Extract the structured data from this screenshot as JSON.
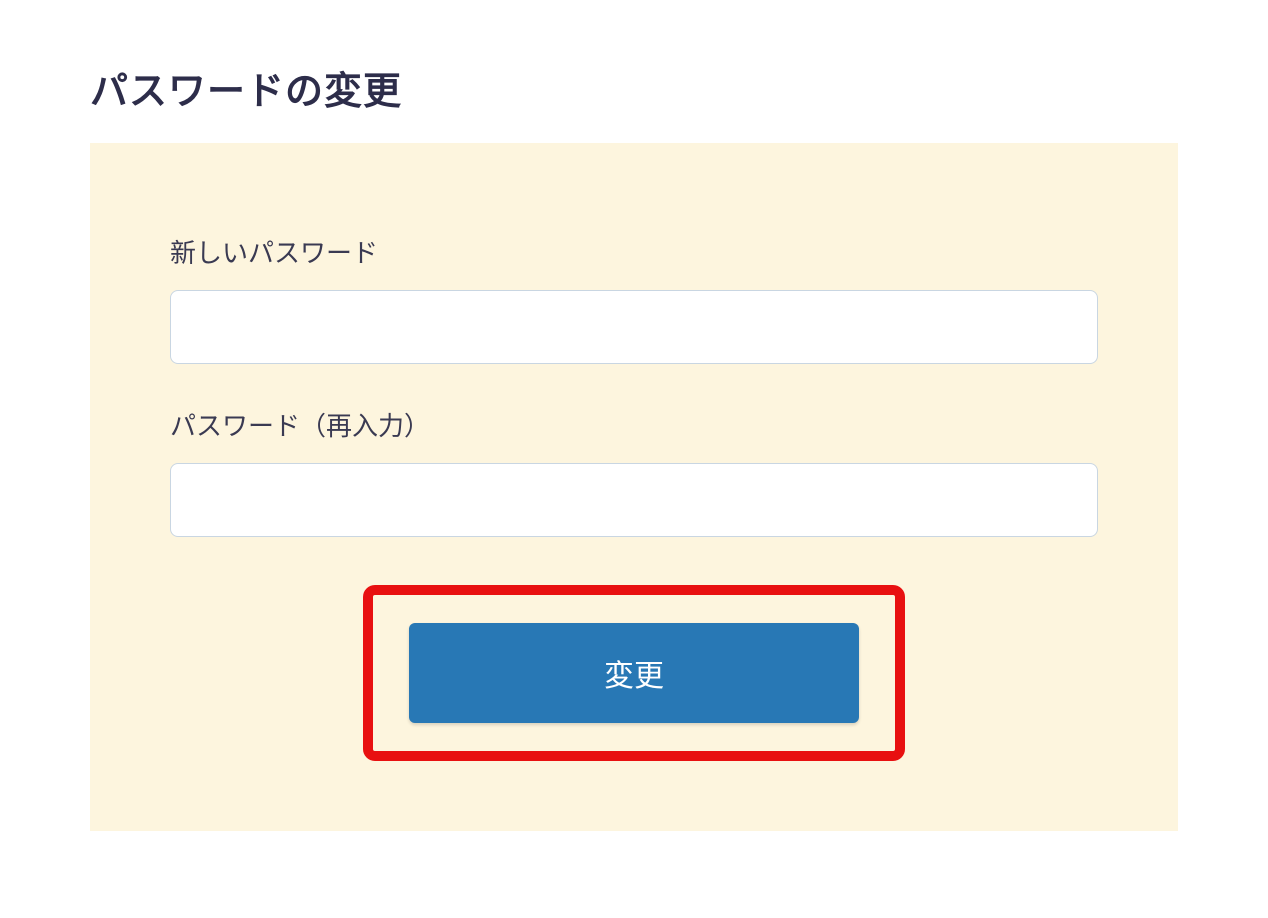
{
  "page": {
    "title": "パスワードの変更"
  },
  "form": {
    "new_password": {
      "label": "新しいパスワード",
      "value": ""
    },
    "confirm_password": {
      "label": "パスワード（再入力）",
      "value": ""
    },
    "submit_label": "変更"
  },
  "colors": {
    "panel_bg": "#fdf5de",
    "button_bg": "#2878b5",
    "highlight_border": "#e81010",
    "title_color": "#2d2d4a"
  }
}
